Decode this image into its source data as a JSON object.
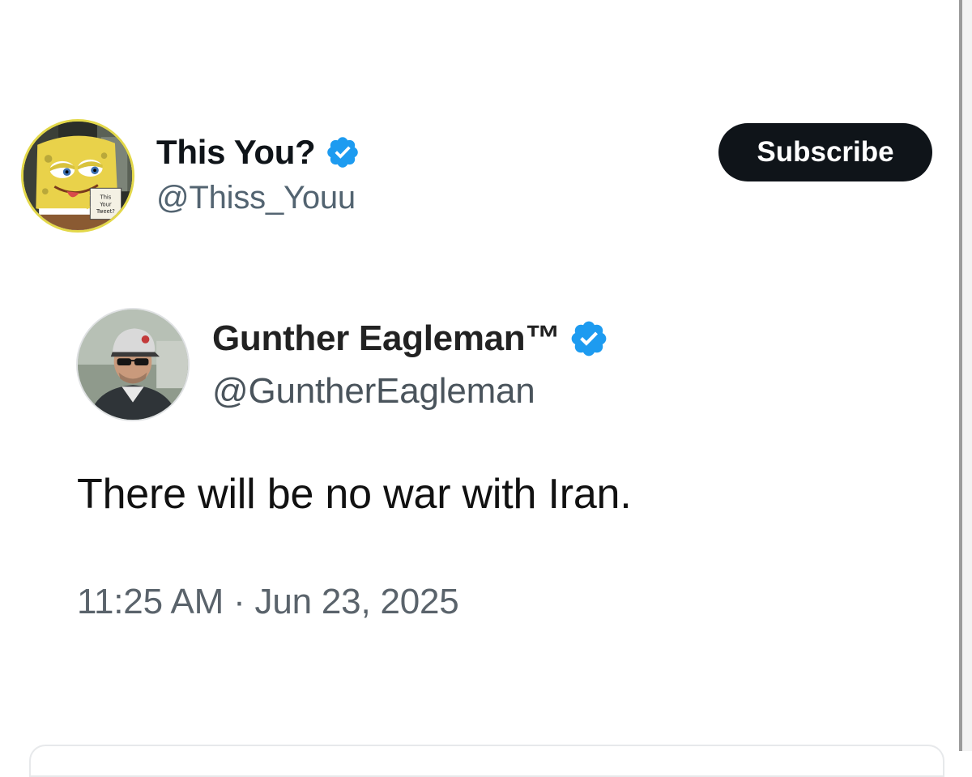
{
  "post": {
    "author": {
      "display_name": "This You?",
      "handle": "@Thiss_Youu",
      "verified": true,
      "avatar_icon": "spongebob-this-your-tweet-avatar",
      "avatar_sign_text": [
        "This",
        "Your",
        "Tweet?"
      ]
    },
    "subscribe_label": "Subscribe"
  },
  "quoted": {
    "author": {
      "display_name": "Gunther Eagleman™",
      "handle": "@GuntherEagleman",
      "verified": true,
      "avatar_icon": "man-in-cap-avatar"
    },
    "text": "There will be no war with Iran.",
    "timestamp": "11:25 AM · Jun 23, 2025"
  },
  "colors": {
    "verified_badge": "#1d9bf0",
    "button_bg": "#0f1419",
    "handle_gray": "#536471"
  }
}
